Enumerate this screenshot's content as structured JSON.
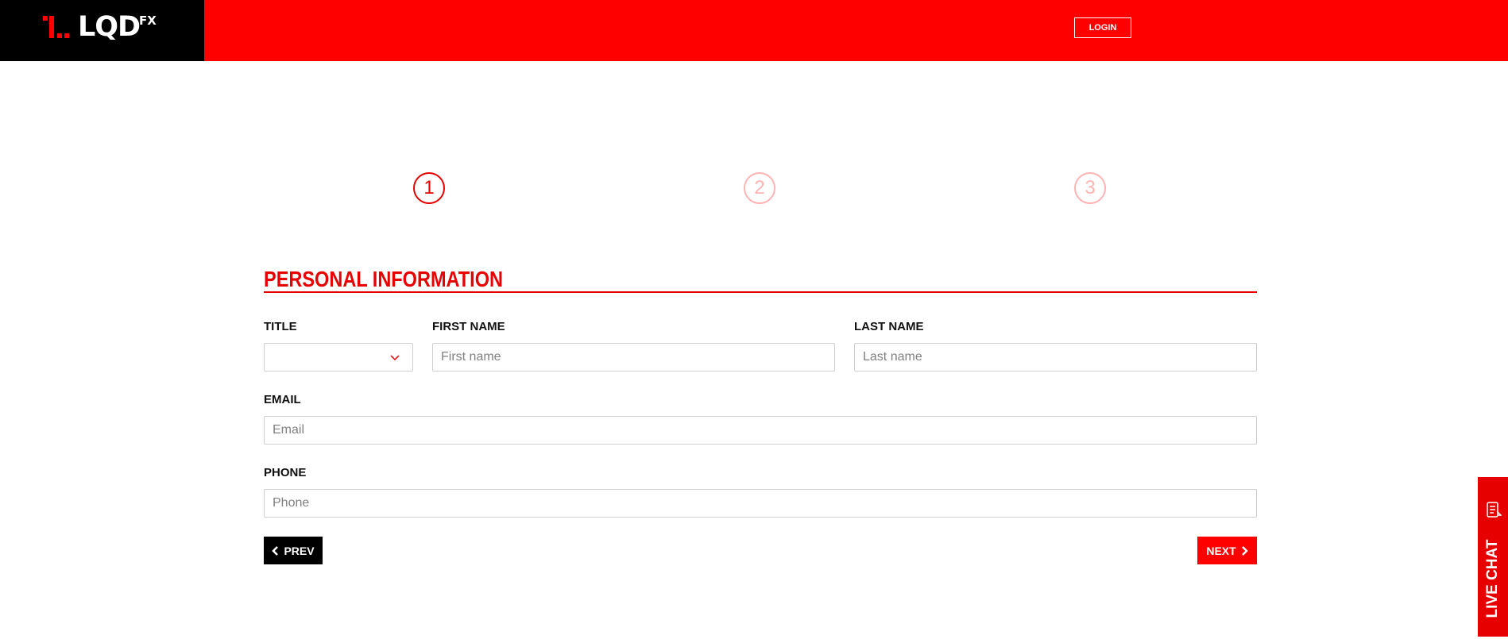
{
  "brand": {
    "logo_text": "LQD",
    "logo_sup": "FX",
    "primary_color": "#ff0000",
    "header_logo_bg": "#000000"
  },
  "header": {
    "login_label": "LOGIN"
  },
  "steps": [
    {
      "number": "1",
      "state": "active"
    },
    {
      "number": "2",
      "state": "inactive"
    },
    {
      "number": "3",
      "state": "inactive"
    }
  ],
  "form": {
    "section_title": "PERSONAL INFORMATION",
    "title_label": "TITLE",
    "title_value": "",
    "first_name_label": "FIRST NAME",
    "first_name_placeholder": "First name",
    "last_name_label": "LAST NAME",
    "last_name_placeholder": "Last name",
    "email_label": "EMAIL",
    "email_placeholder": "Email",
    "phone_label": "PHONE",
    "phone_placeholder": "Phone"
  },
  "nav": {
    "prev_label": "PREV",
    "next_label": "NEXT"
  },
  "live_chat": {
    "label": "LIVE CHAT"
  }
}
